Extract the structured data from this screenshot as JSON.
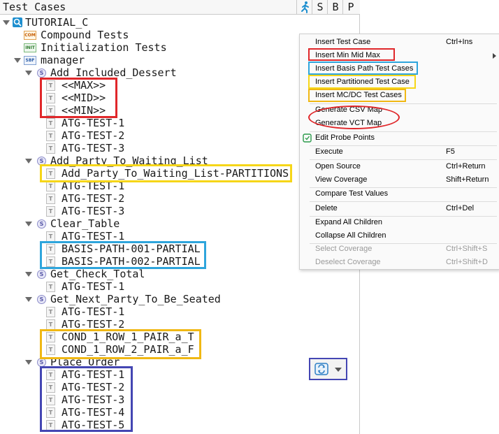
{
  "colors": {
    "red": "#e0272a",
    "yellow": "#f6d618",
    "blue": "#2ea5dc",
    "orange": "#f0b814",
    "navy": "#4446b3",
    "env_icon": "#1e8fcf"
  },
  "header": {
    "title": "Test Cases",
    "col_run_icon": "run-icon",
    "col_s": "S",
    "col_b": "B",
    "col_p": "P"
  },
  "tree": {
    "environment": "TUTORIAL_C",
    "compound": {
      "icon_text": "COM",
      "label": "Compound Tests"
    },
    "init": {
      "icon_text": "INIT",
      "label": "Initialization Tests"
    },
    "unit": {
      "icon_text": "SBF",
      "label": "manager"
    },
    "icons": {
      "subprogram": "S",
      "testcase": "T"
    },
    "funcs": [
      {
        "name": "Add_Included_Dessert",
        "tests": [
          "<<MAX>>",
          "<<MID>>",
          "<<MIN>>",
          "ATG-TEST-1",
          "ATG-TEST-2",
          "ATG-TEST-3"
        ]
      },
      {
        "name": "Add_Party_To_Waiting_List",
        "tests": [
          "Add_Party_To_Waiting_List-PARTITIONS",
          "ATG-TEST-1",
          "ATG-TEST-2",
          "ATG-TEST-3"
        ]
      },
      {
        "name": "Clear_Table",
        "tests": [
          "ATG-TEST-1",
          "BASIS-PATH-001-PARTIAL",
          "BASIS-PATH-002-PARTIAL"
        ]
      },
      {
        "name": "Get_Check_Total",
        "tests": [
          "ATG-TEST-1"
        ]
      },
      {
        "name": "Get_Next_Party_To_Be_Seated",
        "tests": [
          "ATG-TEST-1",
          "ATG-TEST-2",
          "COND_1_ROW_1_PAIR_a_T",
          "COND_1_ROW_2_PAIR_a_F"
        ]
      },
      {
        "name": "Place_Order",
        "tests": [
          "ATG-TEST-1",
          "ATG-TEST-2",
          "ATG-TEST-3",
          "ATG-TEST-4",
          "ATG-TEST-5"
        ]
      }
    ]
  },
  "menu": {
    "items": [
      {
        "label": "Insert Test Case",
        "shortcut": "Ctrl+Ins"
      },
      {
        "label": "Insert Min Mid Max",
        "shortcut": ""
      },
      {
        "label": "Insert Basis Path Test Cases",
        "shortcut": ""
      },
      {
        "label": "Insert Partitioned Test Case",
        "shortcut": ""
      },
      {
        "label": "Insert MC/DC Test Cases",
        "shortcut": ""
      },
      {
        "label": "Generate CSV Map",
        "shortcut": ""
      },
      {
        "label": "Generate VCT Map",
        "shortcut": ""
      },
      {
        "label": "Edit Probe Points",
        "shortcut": ""
      },
      {
        "label": "Execute",
        "shortcut": "F5"
      },
      {
        "label": "Open Source",
        "shortcut": "Ctrl+Return"
      },
      {
        "label": "View Coverage",
        "shortcut": "Shift+Return"
      },
      {
        "label": "Compare Test Values",
        "shortcut": ""
      },
      {
        "label": "Delete",
        "shortcut": "Ctrl+Del"
      },
      {
        "label": "Expand All Children",
        "shortcut": ""
      },
      {
        "label": "Collapse All Children",
        "shortcut": ""
      },
      {
        "label": "Select Coverage",
        "shortcut": "Ctrl+Shift+S"
      },
      {
        "label": "Deselect Coverage",
        "shortcut": "Ctrl+Shift+D"
      }
    ]
  },
  "float_button": {
    "icon": "refresh-icon",
    "dropdown_icon": "chevron-down-icon"
  }
}
